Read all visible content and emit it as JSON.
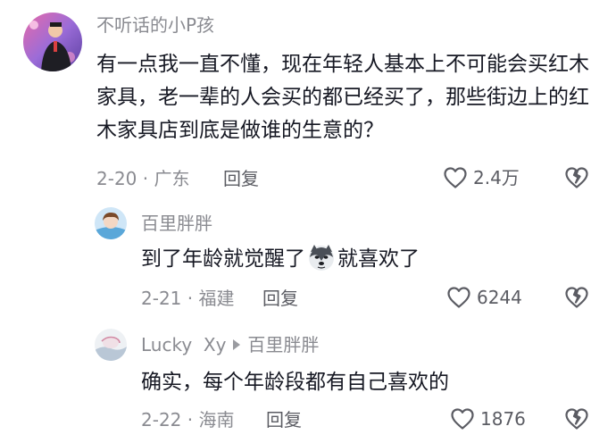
{
  "comments": [
    {
      "username": "不听话的小P孩",
      "text": "有一点我一直不懂，现在年轻人基本上不可能会买红木家具，老一辈的人会买的都已经买了，那些街边上的红木家具店到底是做谁的生意的？",
      "meta": "2-20 · 广东",
      "reply_label": "回复",
      "likes": "2.4万"
    },
    {
      "username": "百里胖胖",
      "text_before": "到了年龄就觉醒了",
      "emoji": "husky-emoji",
      "text_after": "就喜欢了",
      "meta": "2-21 · 福建",
      "reply_label": "回复",
      "likes": "6244"
    },
    {
      "username": "Lucky  Xy",
      "reply_to": "百里胖胖",
      "text": "确实，每个年龄段都有自己喜欢的",
      "meta": "2-22 · 海南",
      "reply_label": "回复",
      "likes": "1876"
    }
  ],
  "icons": {
    "like": "heart-outline-icon",
    "dislike": "broken-heart-icon"
  },
  "colors": {
    "text": "#161823",
    "secondary": "#8a8b91",
    "action": "#5b5c63"
  }
}
